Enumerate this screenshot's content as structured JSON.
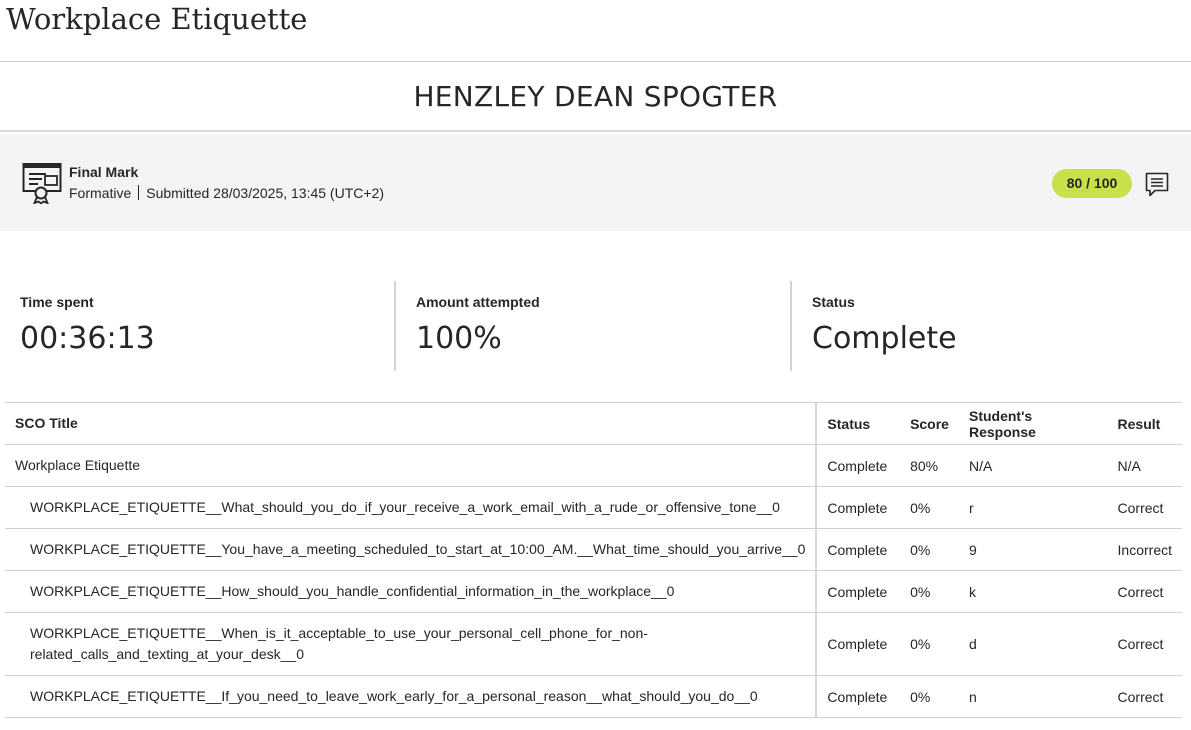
{
  "page": {
    "title": "Workplace Etiquette"
  },
  "student": {
    "name": "HENZLEY DEAN SPOGTER"
  },
  "final_mark": {
    "title": "Final Mark",
    "type": "Formative",
    "submitted": "Submitted 28/03/2025, 13:45 (UTC+2)",
    "score": "80 / 100",
    "score_color": "#c9e04a",
    "icon": "certificate-icon",
    "feedback_icon": "comment-icon"
  },
  "stats": [
    {
      "label": "Time spent",
      "value": "00:36:13"
    },
    {
      "label": "Amount attempted",
      "value": "100%"
    },
    {
      "label": "Status",
      "value": "Complete"
    }
  ],
  "table": {
    "headers": {
      "sco_title": "SCO Title",
      "status": "Status",
      "score": "Score",
      "response": "Student's Response",
      "result": "Result"
    },
    "rows": [
      {
        "title": "Workplace Etiquette",
        "status": "Complete",
        "score": "80%",
        "response": "N/A",
        "result": "N/A"
      },
      {
        "title": "WORKPLACE_ETIQUETTE__What_should_you_do_if_your_receive_a_work_email_with_a_rude_or_offensive_tone__0",
        "status": "Complete",
        "score": "0%",
        "response": "r",
        "result": "Correct"
      },
      {
        "title": "WORKPLACE_ETIQUETTE__You_have_a_meeting_scheduled_to_start_at_10:00_AM.__What_time_should_you_arrive__0",
        "status": "Complete",
        "score": "0%",
        "response": "9",
        "result": "Incorrect"
      },
      {
        "title": "WORKPLACE_ETIQUETTE__How_should_you_handle_confidential_information_in_the_workplace__0",
        "status": "Complete",
        "score": "0%",
        "response": "k",
        "result": "Correct"
      },
      {
        "title": "WORKPLACE_ETIQUETTE__When_is_it_acceptable_to_use_your_personal_cell_phone_for_non-related_calls_and_texting_at_your_desk__0",
        "status": "Complete",
        "score": "0%",
        "response": "d",
        "result": "Correct"
      },
      {
        "title": "WORKPLACE_ETIQUETTE__If_you_need_to_leave_work_early_for_a_personal_reason__what_should_you_do__0",
        "status": "Complete",
        "score": "0%",
        "response": "n",
        "result": "Correct"
      }
    ]
  }
}
